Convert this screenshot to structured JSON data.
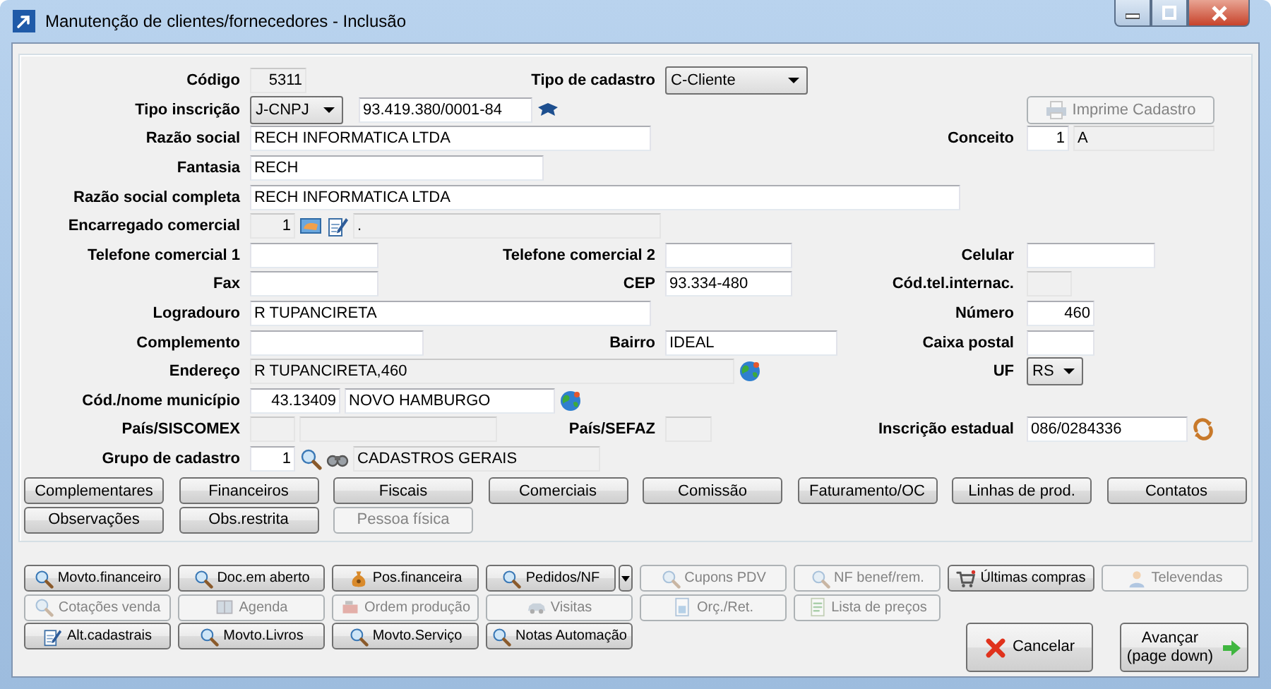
{
  "window": {
    "title": "Manutenção de clientes/fornecedores - Inclusão"
  },
  "form": {
    "rows": [
      {
        "left": {
          "label": "Código",
          "controls": [
            {
              "kind": "field",
              "value": "5311",
              "disabled": true
            }
          ]
        },
        "middle": {
          "label": "Tipo de cadastro",
          "controls": [
            {
              "kind": "select",
              "value": "C-Cliente"
            }
          ]
        }
      },
      {
        "left": {
          "label": "Tipo inscrição",
          "controls": [
            {
              "kind": "select",
              "value": "J-CNPJ"
            },
            {
              "kind": "field",
              "value": "93.419.380/0001-84",
              "disabled": false
            },
            {
              "kind": "icon"
            }
          ]
        },
        "right": {
          "controls": [
            {
              "kind": "button",
              "label": "Imprime Cadastro",
              "disabled": true
            }
          ]
        }
      },
      {
        "left": {
          "label": "Razão social",
          "controls": [
            {
              "kind": "field",
              "value": "RECH INFORMATICA LTDA",
              "disabled": false
            }
          ]
        },
        "right": {
          "label": "Conceito",
          "controls": [
            {
              "kind": "field",
              "value": "1",
              "disabled": false
            },
            {
              "kind": "field",
              "value": "A",
              "disabled": true
            }
          ]
        }
      },
      {
        "left": {
          "label": "Fantasia",
          "controls": [
            {
              "kind": "field",
              "value": "RECH",
              "disabled": false
            }
          ]
        }
      },
      {
        "left": {
          "label": "Razão social completa",
          "controls": [
            {
              "kind": "field",
              "value": "RECH INFORMATICA LTDA",
              "disabled": false
            }
          ]
        }
      },
      {
        "left": {
          "label": "Encarregado comercial",
          "controls": [
            {
              "kind": "field",
              "value": "1",
              "disabled": true
            },
            {
              "kind": "icon"
            },
            {
              "kind": "icon"
            },
            {
              "kind": "field",
              "value": ".",
              "disabled": true
            }
          ]
        }
      },
      {
        "left": {
          "label": "Telefone comercial 1",
          "controls": [
            {
              "kind": "field",
              "disabled": false
            }
          ]
        },
        "middle": {
          "label": "Telefone comercial 2",
          "controls": [
            {
              "kind": "field",
              "disabled": false
            }
          ]
        },
        "right": {
          "label": "Celular",
          "controls": [
            {
              "kind": "field",
              "disabled": false
            }
          ]
        }
      },
      {
        "left": {
          "label": "Fax",
          "controls": [
            {
              "kind": "field",
              "disabled": false
            }
          ]
        },
        "middle": {
          "label": "CEP",
          "controls": [
            {
              "kind": "field",
              "value": "93.334-480",
              "disabled": false
            }
          ]
        },
        "right": {
          "label": "Cód.tel.internac.",
          "controls": [
            {
              "kind": "field",
              "disabled": true
            }
          ]
        }
      },
      {
        "left": {
          "label": "Logradouro",
          "controls": [
            {
              "kind": "field",
              "value": "R TUPANCIRETA",
              "disabled": false
            }
          ]
        },
        "right": {
          "label": "Número",
          "controls": [
            {
              "kind": "field",
              "value": "460",
              "disabled": false
            }
          ]
        }
      },
      {
        "left": {
          "label": "Complemento",
          "controls": [
            {
              "kind": "field",
              "disabled": false
            }
          ]
        },
        "middle": {
          "label": "Bairro",
          "controls": [
            {
              "kind": "field",
              "value": "IDEAL",
              "disabled": false
            }
          ]
        },
        "right": {
          "label": "Caixa postal",
          "controls": [
            {
              "kind": "field",
              "disabled": false
            }
          ]
        }
      },
      {
        "left": {
          "label": "Endereço",
          "controls": [
            {
              "kind": "field",
              "value": "R TUPANCIRETA,460",
              "disabled": true
            },
            {
              "kind": "icon"
            }
          ]
        },
        "right": {
          "label": "UF",
          "controls": [
            {
              "kind": "select",
              "value": "RS"
            }
          ]
        }
      },
      {
        "left": {
          "label": "Cód./nome município",
          "controls": [
            {
              "kind": "field",
              "value": "43.13409",
              "disabled": false
            },
            {
              "kind": "field",
              "value": "NOVO HAMBURGO",
              "disabled": false
            },
            {
              "kind": "icon"
            }
          ]
        }
      },
      {
        "left": {
          "label": "País/SISCOMEX",
          "controls": [
            {
              "kind": "field",
              "disabled": true
            },
            {
              "kind": "field",
              "disabled": true
            }
          ]
        },
        "middle": {
          "label": "País/SEFAZ",
          "controls": [
            {
              "kind": "field",
              "disabled": true
            }
          ]
        },
        "right": {
          "label": "Inscrição estadual",
          "controls": [
            {
              "kind": "field",
              "value": "086/0284336",
              "disabled": false
            },
            {
              "kind": "icon"
            }
          ]
        }
      },
      {
        "left": {
          "label": "Grupo de cadastro",
          "controls": [
            {
              "kind": "field",
              "value": "1",
              "disabled": false
            },
            {
              "kind": "icon"
            },
            {
              "kind": "icon"
            },
            {
              "kind": "field",
              "value": "CADASTROS GERAIS",
              "disabled": true
            }
          ]
        }
      }
    ]
  },
  "tabs": [
    {
      "label": "Complementares",
      "disabled": false
    },
    {
      "label": "Financeiros",
      "disabled": false
    },
    {
      "label": "Fiscais",
      "disabled": false
    },
    {
      "label": "Comerciais",
      "disabled": false
    },
    {
      "label": "Comissão",
      "disabled": false
    },
    {
      "label": "Faturamento/OC",
      "disabled": false
    },
    {
      "label": "Linhas de prod.",
      "disabled": false
    },
    {
      "label": "Contatos",
      "disabled": false
    },
    {
      "label": "Observações",
      "disabled": false
    },
    {
      "label": "Obs.restrita",
      "disabled": false
    },
    {
      "label": "Pessoa física",
      "disabled": true
    }
  ],
  "actions": [
    {
      "buttons": [
        {
          "kind": "button",
          "label": "Movto.financeiro",
          "disabled": false
        },
        {
          "kind": "button",
          "label": "Doc.em aberto",
          "disabled": false
        },
        {
          "kind": "button",
          "label": "Pos.financeira",
          "disabled": false
        },
        {
          "kind": "split",
          "label": "Pedidos/NF",
          "disabled": false
        },
        {
          "kind": "button",
          "label": "Cupons PDV",
          "disabled": true
        },
        {
          "kind": "button",
          "label": "NF benef/rem.",
          "disabled": true
        },
        {
          "kind": "button",
          "label": "Últimas compras",
          "disabled": false
        },
        {
          "kind": "button",
          "label": "Televendas",
          "disabled": true
        }
      ]
    },
    {
      "buttons": [
        {
          "kind": "button",
          "label": "Cotações venda",
          "disabled": true
        },
        {
          "kind": "button",
          "label": "Agenda",
          "disabled": true
        },
        {
          "kind": "button",
          "label": "Ordem produção",
          "disabled": true
        },
        {
          "kind": "button",
          "label": "Visitas",
          "disabled": true
        },
        {
          "kind": "button",
          "label": "Orç./Ret.",
          "disabled": true
        },
        {
          "kind": "button",
          "label": "Lista de preços",
          "disabled": true
        }
      ]
    },
    {
      "buttons": [
        {
          "kind": "button",
          "label": "Alt.cadastrais",
          "disabled": false
        },
        {
          "kind": "button",
          "label": "Movto.Livros",
          "disabled": false
        },
        {
          "kind": "button",
          "label": "Movto.Serviço",
          "disabled": false
        },
        {
          "kind": "button",
          "label": "Notas Automação",
          "disabled": false
        }
      ]
    }
  ],
  "footer": [
    {
      "label": "Cancelar"
    },
    {
      "label": "Avançar (page down)"
    }
  ]
}
